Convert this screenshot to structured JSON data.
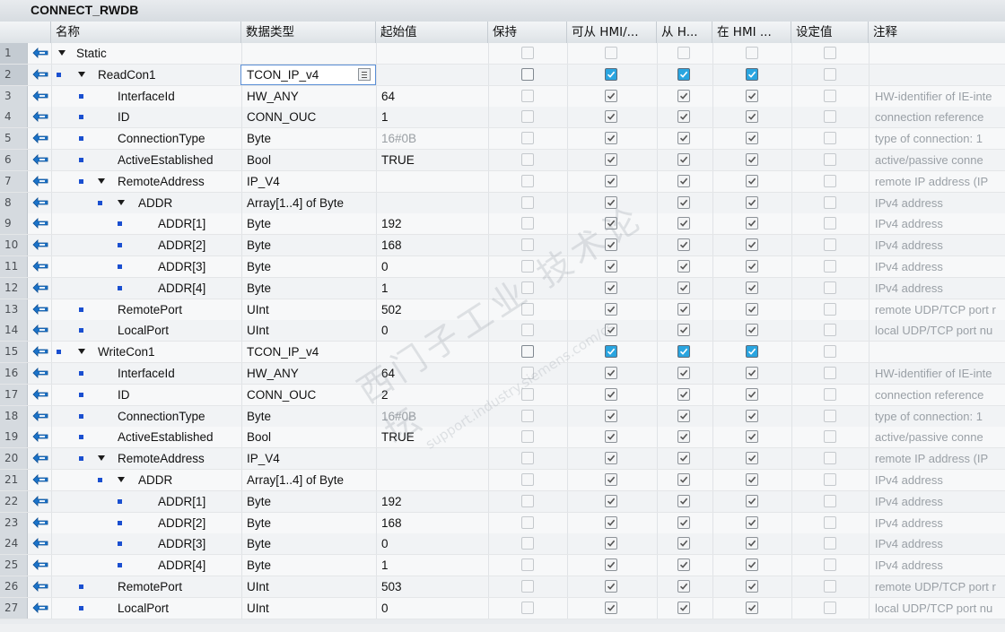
{
  "title": "CONNECT_RWDB",
  "columns": {
    "name": "名称",
    "datatype": "数据类型",
    "start_value": "起始值",
    "retain": "保持",
    "hmi_access": "可从 HMI/...",
    "hmi_write": "从 H...",
    "hmi_visible": "在 HMI ...",
    "setpoint": "设定值",
    "comment": "注释"
  },
  "watermark": {
    "line1": "西门子工业  技术论坛",
    "line2": "support.industry.siemens.com/cs"
  },
  "rows": [
    {
      "num": "1",
      "name": "Static",
      "type": "",
      "value": "",
      "comment": "",
      "level": 0,
      "expand": true,
      "bullet": false,
      "hmi": [
        false,
        false,
        false
      ],
      "retain": false,
      "retain_dark": false,
      "grey": false
    },
    {
      "num": "2",
      "name": "ReadCon1",
      "type": "TCON_IP_v4",
      "value": "",
      "comment": "",
      "level": 1,
      "expand": true,
      "bullet": true,
      "hmi": [
        true,
        true,
        true
      ],
      "retain": false,
      "retain_dark": true,
      "grey": false,
      "selected": true,
      "blue": true
    },
    {
      "num": "3",
      "name": "InterfaceId",
      "type": "HW_ANY",
      "value": "64",
      "comment": "HW-identifier of IE-inte",
      "level": 2,
      "expand": false,
      "bullet": true,
      "hmi": [
        true,
        true,
        true
      ]
    },
    {
      "num": "4",
      "name": "ID",
      "type": "CONN_OUC",
      "value": "1",
      "comment": "connection reference",
      "level": 2,
      "expand": false,
      "bullet": true,
      "hmi": [
        true,
        true,
        true
      ]
    },
    {
      "num": "5",
      "name": "ConnectionType",
      "type": "Byte",
      "value": "16#0B",
      "comment": "type of connection: 1",
      "level": 2,
      "expand": false,
      "bullet": true,
      "hmi": [
        true,
        true,
        true
      ],
      "grey": true
    },
    {
      "num": "6",
      "name": "ActiveEstablished",
      "type": "Bool",
      "value": "TRUE",
      "comment": "active/passive conne",
      "level": 2,
      "expand": false,
      "bullet": true,
      "hmi": [
        true,
        true,
        true
      ]
    },
    {
      "num": "7",
      "name": "RemoteAddress",
      "type": "IP_V4",
      "value": "",
      "comment": "remote IP address (IP",
      "level": 2,
      "expand": true,
      "bullet": true,
      "hmi": [
        true,
        true,
        true
      ]
    },
    {
      "num": "8",
      "name": "ADDR",
      "type": "Array[1..4] of Byte",
      "value": "",
      "comment": "IPv4 address",
      "level": 3,
      "expand": true,
      "bullet": true,
      "hmi": [
        true,
        true,
        true
      ]
    },
    {
      "num": "9",
      "name": "ADDR[1]",
      "type": "Byte",
      "value": "192",
      "comment": "IPv4 address",
      "level": 4,
      "expand": false,
      "bullet": true,
      "hmi": [
        true,
        true,
        true
      ]
    },
    {
      "num": "10",
      "name": "ADDR[2]",
      "type": "Byte",
      "value": "168",
      "comment": "IPv4 address",
      "level": 4,
      "expand": false,
      "bullet": true,
      "hmi": [
        true,
        true,
        true
      ]
    },
    {
      "num": "11",
      "name": "ADDR[3]",
      "type": "Byte",
      "value": "0",
      "comment": "IPv4 address",
      "level": 4,
      "expand": false,
      "bullet": true,
      "hmi": [
        true,
        true,
        true
      ]
    },
    {
      "num": "12",
      "name": "ADDR[4]",
      "type": "Byte",
      "value": "1",
      "comment": "IPv4 address",
      "level": 4,
      "expand": false,
      "bullet": true,
      "hmi": [
        true,
        true,
        true
      ]
    },
    {
      "num": "13",
      "name": "RemotePort",
      "type": "UInt",
      "value": "502",
      "comment": "remote UDP/TCP port r",
      "level": 2,
      "expand": false,
      "bullet": true,
      "hmi": [
        true,
        true,
        true
      ]
    },
    {
      "num": "14",
      "name": "LocalPort",
      "type": "UInt",
      "value": "0",
      "comment": "local UDP/TCP port nu",
      "level": 2,
      "expand": false,
      "bullet": true,
      "hmi": [
        true,
        true,
        true
      ]
    },
    {
      "num": "15",
      "name": "WriteCon1",
      "type": "TCON_IP_v4",
      "value": "",
      "comment": "",
      "level": 1,
      "expand": true,
      "bullet": true,
      "hmi": [
        true,
        true,
        true
      ],
      "retain_dark": true,
      "blue": true
    },
    {
      "num": "16",
      "name": "InterfaceId",
      "type": "HW_ANY",
      "value": "64",
      "comment": "HW-identifier of IE-inte",
      "level": 2,
      "expand": false,
      "bullet": true,
      "hmi": [
        true,
        true,
        true
      ]
    },
    {
      "num": "17",
      "name": "ID",
      "type": "CONN_OUC",
      "value": "2",
      "comment": "connection reference",
      "level": 2,
      "expand": false,
      "bullet": true,
      "hmi": [
        true,
        true,
        true
      ]
    },
    {
      "num": "18",
      "name": "ConnectionType",
      "type": "Byte",
      "value": "16#0B",
      "comment": "type of connection: 1",
      "level": 2,
      "expand": false,
      "bullet": true,
      "hmi": [
        true,
        true,
        true
      ],
      "grey": true
    },
    {
      "num": "19",
      "name": "ActiveEstablished",
      "type": "Bool",
      "value": "TRUE",
      "comment": "active/passive conne",
      "level": 2,
      "expand": false,
      "bullet": true,
      "hmi": [
        true,
        true,
        true
      ]
    },
    {
      "num": "20",
      "name": "RemoteAddress",
      "type": "IP_V4",
      "value": "",
      "comment": "remote IP address (IP",
      "level": 2,
      "expand": true,
      "bullet": true,
      "hmi": [
        true,
        true,
        true
      ]
    },
    {
      "num": "21",
      "name": "ADDR",
      "type": "Array[1..4] of Byte",
      "value": "",
      "comment": "IPv4 address",
      "level": 3,
      "expand": true,
      "bullet": true,
      "hmi": [
        true,
        true,
        true
      ]
    },
    {
      "num": "22",
      "name": "ADDR[1]",
      "type": "Byte",
      "value": "192",
      "comment": "IPv4 address",
      "level": 4,
      "expand": false,
      "bullet": true,
      "hmi": [
        true,
        true,
        true
      ]
    },
    {
      "num": "23",
      "name": "ADDR[2]",
      "type": "Byte",
      "value": "168",
      "comment": "IPv4 address",
      "level": 4,
      "expand": false,
      "bullet": true,
      "hmi": [
        true,
        true,
        true
      ]
    },
    {
      "num": "24",
      "name": "ADDR[3]",
      "type": "Byte",
      "value": "0",
      "comment": "IPv4 address",
      "level": 4,
      "expand": false,
      "bullet": true,
      "hmi": [
        true,
        true,
        true
      ]
    },
    {
      "num": "25",
      "name": "ADDR[4]",
      "type": "Byte",
      "value": "1",
      "comment": "IPv4 address",
      "level": 4,
      "expand": false,
      "bullet": true,
      "hmi": [
        true,
        true,
        true
      ]
    },
    {
      "num": "26",
      "name": "RemotePort",
      "type": "UInt",
      "value": "503",
      "comment": "remote UDP/TCP port r",
      "level": 2,
      "expand": false,
      "bullet": true,
      "hmi": [
        true,
        true,
        true
      ]
    },
    {
      "num": "27",
      "name": "LocalPort",
      "type": "UInt",
      "value": "0",
      "comment": "local UDP/TCP port nu",
      "level": 2,
      "expand": false,
      "bullet": true,
      "hmi": [
        true,
        true,
        true
      ]
    }
  ]
}
